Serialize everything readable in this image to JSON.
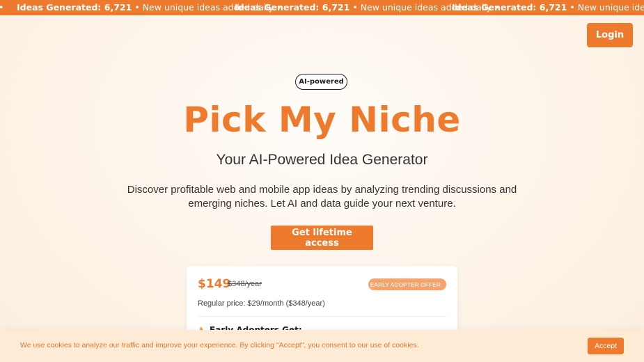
{
  "ticker": {
    "lead_bullet": "•",
    "items": [
      {
        "strong": "Ideas Generated: 6,721",
        "text": "New unique ideas added daily",
        "bullet": "•"
      },
      {
        "strong": "Ideas Generated: 6,721",
        "text": "New unique ideas added daily",
        "bullet": "•"
      },
      {
        "strong": "Ideas Generated: 6,721",
        "text": "New unique ideas added daily",
        "bullet": "•"
      }
    ]
  },
  "header": {
    "login_label": "Login"
  },
  "hero": {
    "badge": "AI-powered",
    "title": "Pick My Niche",
    "subtitle": "Your AI-Powered Idea Generator",
    "description": "Discover profitable web and mobile app ideas by analyzing trending discussions and emerging niches. Let AI and data guide your next venture.",
    "cta_label": "Get lifetime access"
  },
  "pricing": {
    "price": "$149",
    "old_price": "$348/year",
    "offer_badge": "EARLY ADOPTER OFFER",
    "regular_price": "Regular price: $29/month ($348/year)",
    "early_adopters_heading": "Early Adopters Get:"
  },
  "cookie": {
    "text": "We use cookies to analyze our traffic and improve your experience. By clicking \"Accept\", you consent to our use of cookies.",
    "accept_label": "Accept"
  },
  "colors": {
    "accent": "#ee7a2e",
    "offer_pill": "#f4a36b",
    "cookie_bg": "#fdebd6",
    "warning_icon": "#f0a020"
  }
}
